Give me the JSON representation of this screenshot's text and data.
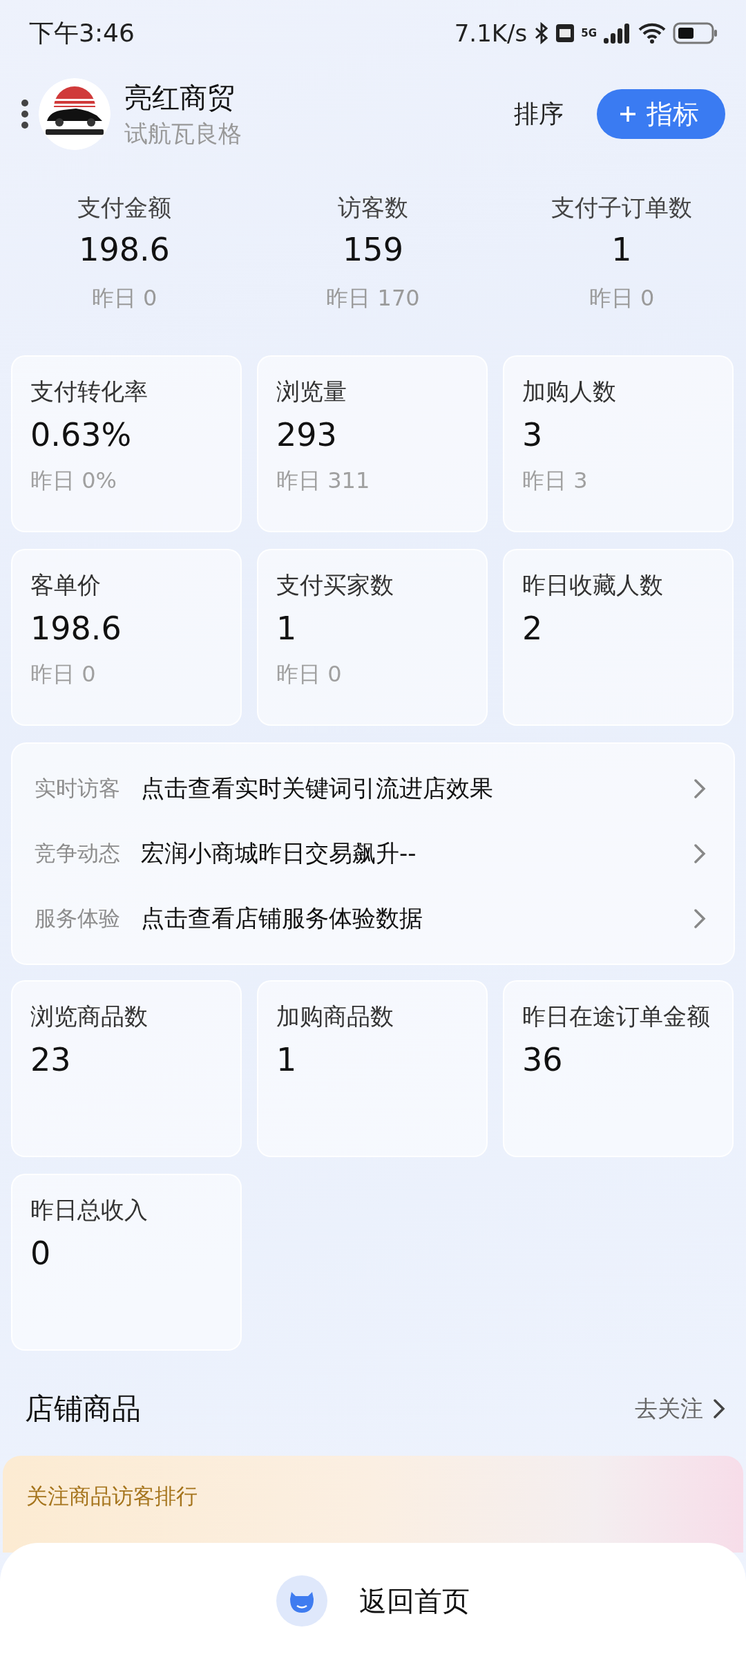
{
  "status_bar": {
    "time": "下午3:46",
    "speed": "7.1K/s",
    "network": "5G"
  },
  "header": {
    "shop_name": "亮红商贸",
    "subtitle": "试航瓦良格",
    "sort": "排序",
    "add_button": "指标"
  },
  "summary": [
    {
      "label": "支付金额",
      "value": "198.6",
      "yesterday": "昨日 0"
    },
    {
      "label": "访客数",
      "value": "159",
      "yesterday": "昨日 170"
    },
    {
      "label": "支付子订单数",
      "value": "1",
      "yesterday": "昨日 0"
    }
  ],
  "metric_cards": [
    {
      "label": "支付转化率",
      "value": "0.63%",
      "yesterday": "昨日 0%"
    },
    {
      "label": "浏览量",
      "value": "293",
      "yesterday": "昨日 311"
    },
    {
      "label": "加购人数",
      "value": "3",
      "yesterday": "昨日 3"
    },
    {
      "label": "客单价",
      "value": "198.6",
      "yesterday": "昨日 0"
    },
    {
      "label": "支付买家数",
      "value": "1",
      "yesterday": "昨日 0"
    },
    {
      "label": "昨日收藏人数",
      "value": "2"
    }
  ],
  "info_rows": [
    {
      "label": "实时访客",
      "text": "点击查看实时关键词引流进店效果"
    },
    {
      "label": "竞争动态",
      "text": "宏润小商城昨日交易飙升--"
    },
    {
      "label": "服务体验",
      "text": "点击查看店铺服务体验数据"
    }
  ],
  "product_cards": [
    {
      "label": "浏览商品数",
      "value": "23"
    },
    {
      "label": "加购商品数",
      "value": "1"
    },
    {
      "label": "昨日在途订单金额",
      "value": "36"
    },
    {
      "label": "昨日总收入",
      "value": "0"
    }
  ],
  "store_section": {
    "title": "店铺商品",
    "link": "去关注",
    "banner": "关注商品访客排行"
  },
  "bottom_bar": {
    "label": "返回首页"
  }
}
